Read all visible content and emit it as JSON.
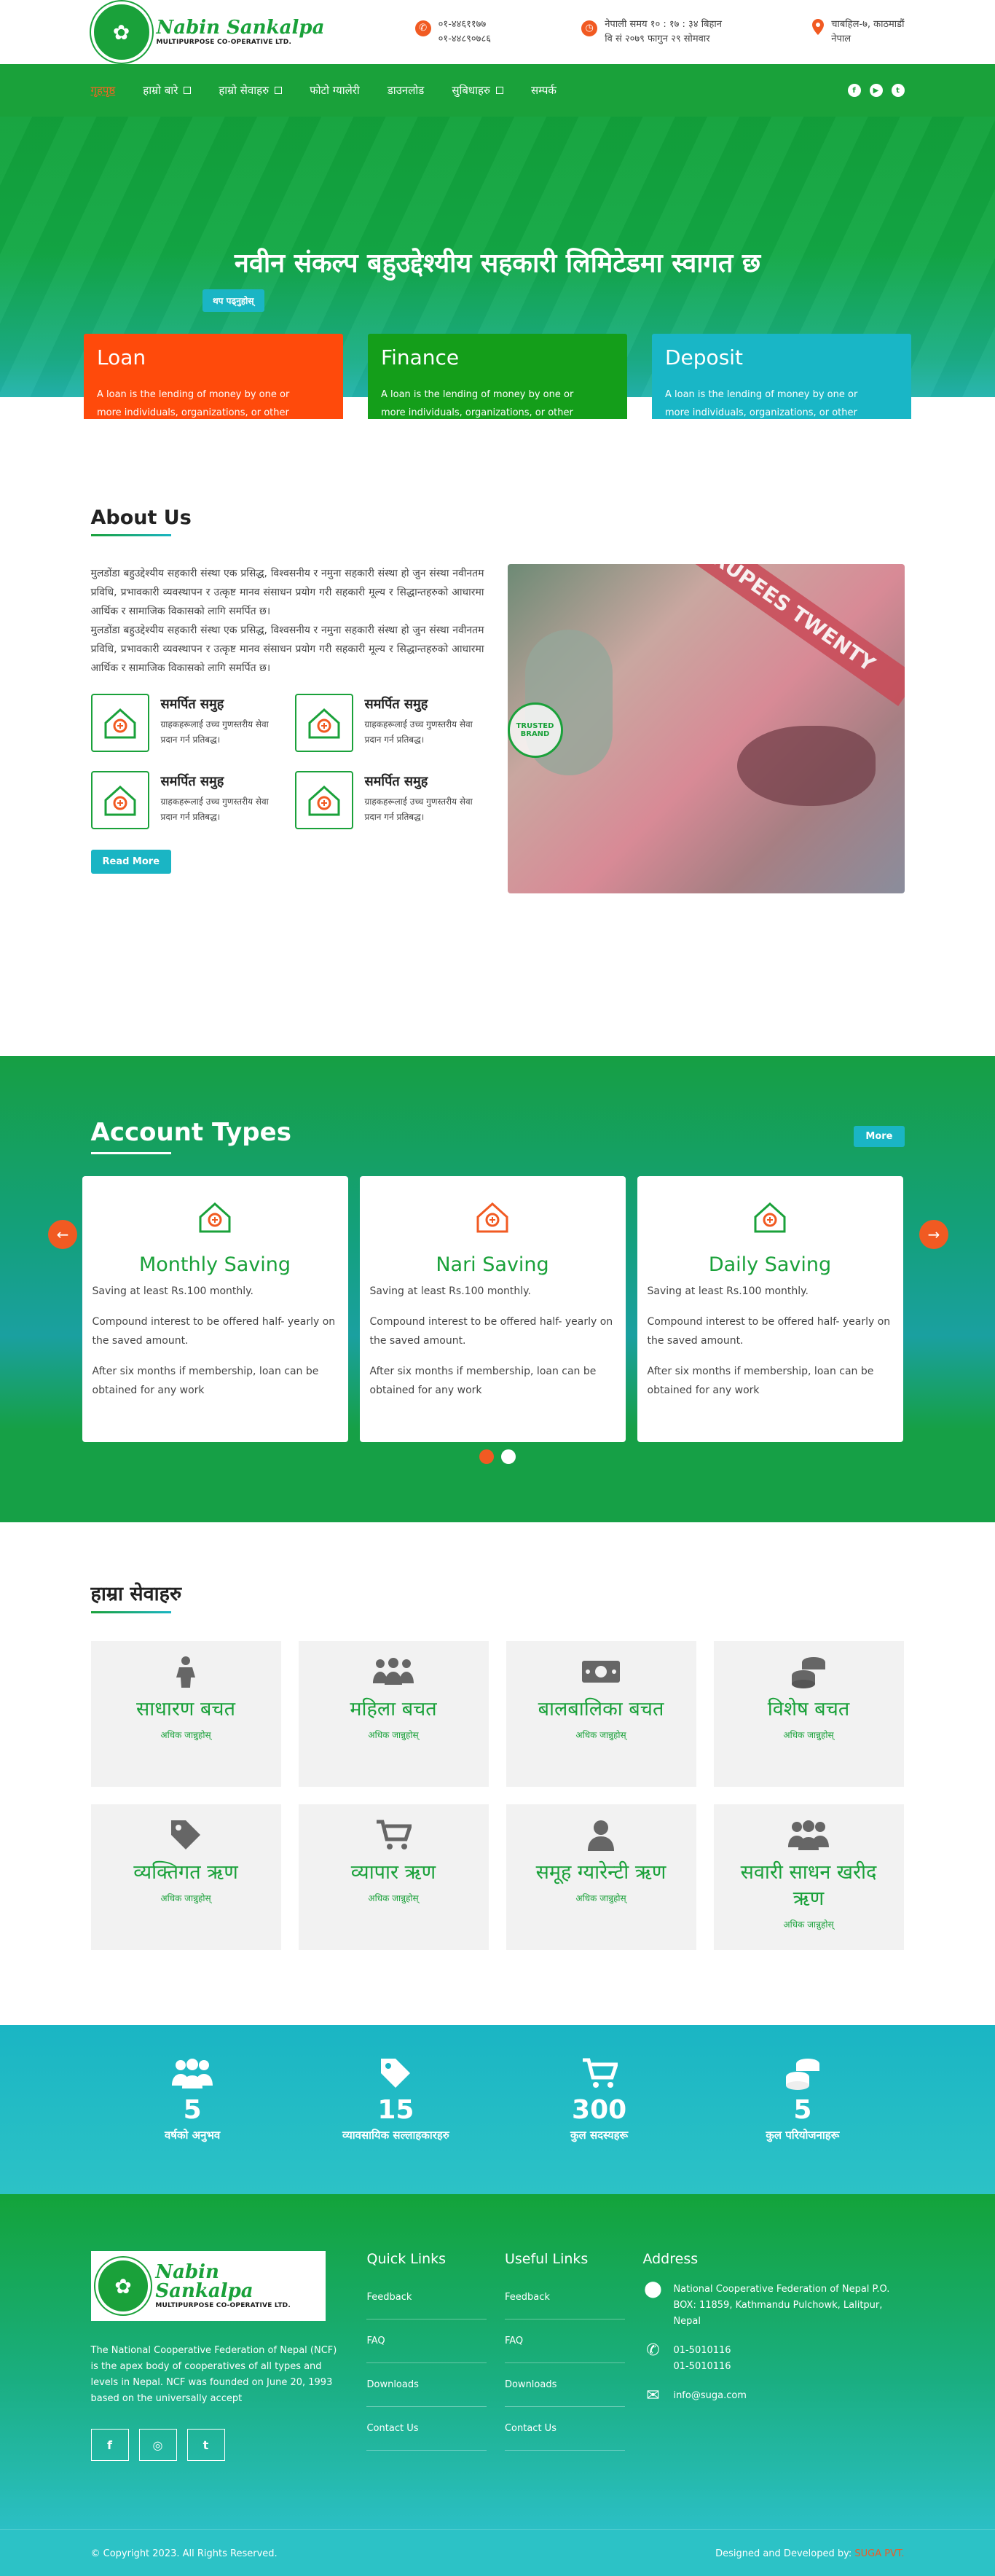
{
  "header": {
    "logo_title": "Nabin Sankalpa",
    "logo_subtitle": "MULTIPURPOSE CO-OPERATIVE LTD.",
    "phone1": "०१-४४६११७७",
    "phone2": "०१-४४८९०७८६",
    "time_line1": "नेपाली समय १० : १७ : ३४ बिहान",
    "time_line2": "वि सं २०७९ फागुन २९ सोमवार",
    "address_line1": "चाबहिल-७, काठमाडौं",
    "address_line2": "नेपाल"
  },
  "nav": {
    "items": [
      {
        "label": "गृहपृष्ठ",
        "caret": false
      },
      {
        "label": "हाम्रो बारे",
        "caret": true
      },
      {
        "label": "हाम्रो सेवाहरु",
        "caret": true
      },
      {
        "label": "फोटो ग्यालेरी",
        "caret": false
      },
      {
        "label": "डाउनलोड",
        "caret": false
      },
      {
        "label": "सुबिधाहरु",
        "caret": true
      },
      {
        "label": "सम्पर्क",
        "caret": false
      }
    ],
    "social": [
      "f",
      "▶",
      "t"
    ]
  },
  "hero": {
    "title": "नवीन संकल्प बहुउद्देश्यीय सहकारी लिमिटेडमा स्वागत छ",
    "button": "थप पढ्नुहोस्"
  },
  "features": [
    {
      "title": "Loan",
      "text": "A loan is the lending of money by one or more individuals, organizations, or other entities to other individuals.",
      "color": "#ff4a0b"
    },
    {
      "title": "Finance",
      "text": "A loan is the lending of money by one or more individuals, organizations, or other entities to other individuals.",
      "color": "#149e1a"
    },
    {
      "title": "Deposit",
      "text": "A loan is the lending of money by one or more individuals, organizations, or other entities to other individuals.",
      "color": "#19b6c6"
    }
  ],
  "about": {
    "title": "About Us",
    "para1": "मुलडोंडा बहुउद्देश्यीय सहकारी संस्था एक प्रसिद्ध, विश्वसनीय र नमुना सहकारी संस्था हो जुन संस्था नवीनतम प्रविधि, प्रभावकारी व्यवस्थापन र उत्कृष्ट मानव संसाधन प्रयोग गरी सहकारी मूल्य र सिद्धान्तहरुको आधारमा आर्थिक र सामाजिक विकासको लागि समर्पित छ।",
    "para2": "मुलडोंडा बहुउद्देश्यीय सहकारी संस्था एक प्रसिद्ध, विश्वसनीय र नमुना सहकारी संस्था हो जुन संस्था नवीनतम प्रविधि, प्रभावकारी व्यवस्थापन र उत्कृष्ट मानव संसाधन प्रयोग गरी सहकारी मूल्य र सिद्धान्तहरुको आधारमा आर्थिक र सामाजिक विकासको लागि समर्पित छ।",
    "items": [
      {
        "title": "समर्पित समुह",
        "text": "ग्राहकहरूलाई उच्च गुणस्तरीय सेवा प्रदान गर्न प्रतिबद्ध।",
        "icon": "house-rupee-icon"
      },
      {
        "title": "समर्पित समुह",
        "text": "ग्राहकहरूलाई उच्च गुणस्तरीय सेवा प्रदान गर्न प्रतिबद्ध।",
        "icon": "coin-cycle-icon"
      },
      {
        "title": "समर्पित समुह",
        "text": "ग्राहकहरूलाई उच्च गुणस्तरीय सेवा प्रदान गर्न प्रतिबद्ध।",
        "icon": "money-bag-hand-icon"
      },
      {
        "title": "समर्पित समुह",
        "text": "ग्राहकहरूलाई उच्च गुणस्तरीय सेवा प्रदान गर्न प्रतिबद्ध।",
        "icon": "coin-hand-icon"
      }
    ],
    "read_more": "Read More",
    "image_banner": "RUPEES TWENTY",
    "stamp": "TRUSTED BRAND"
  },
  "accounts": {
    "title": "Account Types",
    "more": "More",
    "cards": [
      {
        "title": "Monthly Saving",
        "p1": "Saving at least Rs.100 monthly.",
        "p2": "Compound interest to be offered half- yearly on the saved amount.",
        "p3": "After six months if membership, loan can be obtained for any work",
        "icon": "shop-icon"
      },
      {
        "title": "Nari Saving",
        "p1": "Saving at least Rs.100 monthly.",
        "p2": "Compound interest to be offered half- yearly on the saved amount.",
        "p3": "After six months if membership, loan can be obtained for any work",
        "icon": "document-building-icon"
      },
      {
        "title": "Daily Saving",
        "p1": "Saving at least Rs.100 monthly.",
        "p2": "Compound interest to be offered half- yearly on the saved amount.",
        "p3": "After six months if membership, loan can be obtained for any work",
        "icon": "house-rupee-hand-icon"
      }
    ]
  },
  "services": {
    "title": "हाम्रा सेवाहरु",
    "link": "अधिक जान्नुहोस्",
    "items": [
      {
        "title": "साधारण बचत",
        "icon": "person-icon"
      },
      {
        "title": "महिला बचत",
        "icon": "group-icon"
      },
      {
        "title": "बालबालिका बचत",
        "icon": "money-icon"
      },
      {
        "title": "विशेष बचत",
        "icon": "coins-icon"
      },
      {
        "title": "व्यक्तिगत ऋण",
        "icon": "tag-icon"
      },
      {
        "title": "व्यापार ऋण",
        "icon": "cart-icon"
      },
      {
        "title": "समूह ग्यारेन्टी ऋण",
        "icon": "user-icon"
      },
      {
        "title": "सवारी साधन खरीद ऋण",
        "icon": "users-icon"
      }
    ]
  },
  "counters": [
    {
      "num": "5",
      "label": "वर्षको अनुभव",
      "icon": "users-icon"
    },
    {
      "num": "15",
      "label": "व्यावसायिक सल्लाहकारहरु",
      "icon": "tag-icon"
    },
    {
      "num": "300",
      "label": "कुल सदस्यहरू",
      "icon": "cart-icon"
    },
    {
      "num": "5",
      "label": "कुल परियोजनाहरू",
      "icon": "coins-icon"
    }
  ],
  "footer": {
    "about": "The National Cooperative Federation of Nepal (NCF) is the apex body of cooperatives of all types and levels in Nepal. NCF was founded on June 20, 1993 based on the universally accept",
    "quick_title": "Quick Links",
    "useful_title": "Useful Links",
    "links": [
      "Feedback",
      "FAQ",
      "Downloads",
      "Contact Us"
    ],
    "address_title": "Address",
    "address": "National Cooperative Federation of Nepal P.O. BOX: 11859, Kathmandu Pulchowk, Lalitpur, Nepal",
    "phone1": "01-5010116",
    "phone2": "01-5010116",
    "email": "info@suga.com",
    "social": [
      "f",
      "◎",
      "t"
    ],
    "copyright": "© Copyright 2023. All Rights Reserved.",
    "designed_by": "Designed and Developed by:",
    "designer": "SUGA PVT."
  }
}
